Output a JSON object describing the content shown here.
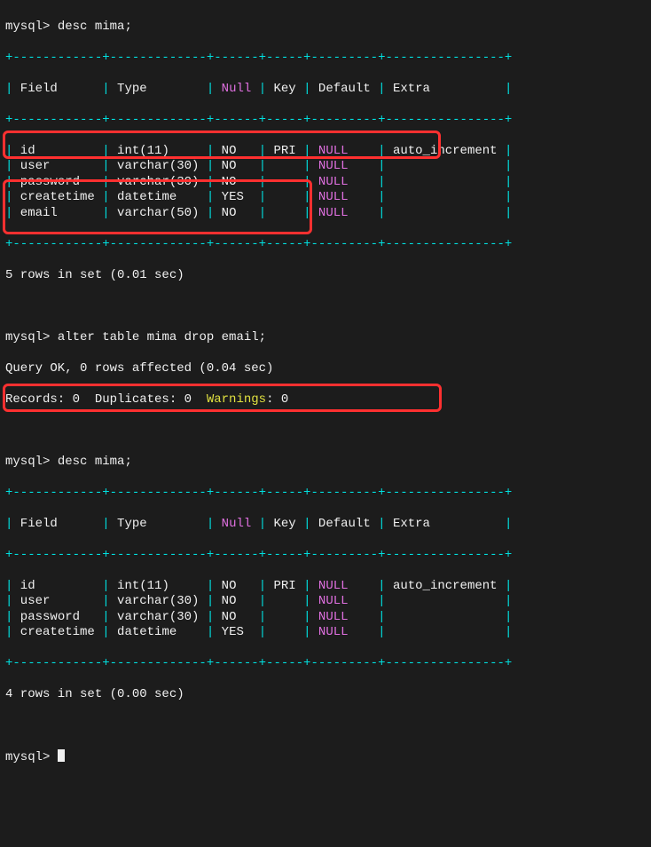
{
  "prompt": "mysql>",
  "cmd1": "desc mima;",
  "table1": {
    "header": [
      "Field",
      "Type",
      "Null",
      "Key",
      "Default",
      "Extra"
    ],
    "rows": [
      {
        "field": "id",
        "type": "int(11)",
        "null": "NO",
        "key": "PRI",
        "default": "NULL",
        "extra": "auto_increment"
      },
      {
        "field": "user",
        "type": "varchar(30)",
        "null": "NO",
        "key": "",
        "default": "NULL",
        "extra": ""
      },
      {
        "field": "password",
        "type": "varchar(30)",
        "null": "NO",
        "key": "",
        "default": "NULL",
        "extra": ""
      },
      {
        "field": "createtime",
        "type": "datetime",
        "null": "YES",
        "key": "",
        "default": "NULL",
        "extra": ""
      },
      {
        "field": "email",
        "type": "varchar(50)",
        "null": "NO",
        "key": "",
        "default": "NULL",
        "extra": ""
      }
    ],
    "footer": "5 rows in set (0.01 sec)"
  },
  "cmd2": "alter table mima drop email;",
  "cmd2_result": {
    "line1": "Query OK, 0 rows affected (0.04 sec)",
    "line2_prefix": "Records: 0  Duplicates: 0  ",
    "line2_warn_label": "Warnings",
    "line2_warn_rest": ": 0"
  },
  "cmd3": "desc mima;",
  "table2": {
    "header": [
      "Field",
      "Type",
      "Null",
      "Key",
      "Default",
      "Extra"
    ],
    "rows": [
      {
        "field": "id",
        "type": "int(11)",
        "null": "NO",
        "key": "PRI",
        "default": "NULL",
        "extra": "auto_increment"
      },
      {
        "field": "user",
        "type": "varchar(30)",
        "null": "NO",
        "key": "",
        "default": "NULL",
        "extra": ""
      },
      {
        "field": "password",
        "type": "varchar(30)",
        "null": "NO",
        "key": "",
        "default": "NULL",
        "extra": ""
      },
      {
        "field": "createtime",
        "type": "datetime",
        "null": "YES",
        "key": "",
        "default": "NULL",
        "extra": ""
      }
    ],
    "footer": "4 rows in set (0.00 sec)"
  },
  "border": "+------------+-------------+------+-----+---------+----------------+",
  "w": {
    "field": 12,
    "type": 13,
    "null": 6,
    "key": 5,
    "default": 9,
    "extra": 16
  }
}
